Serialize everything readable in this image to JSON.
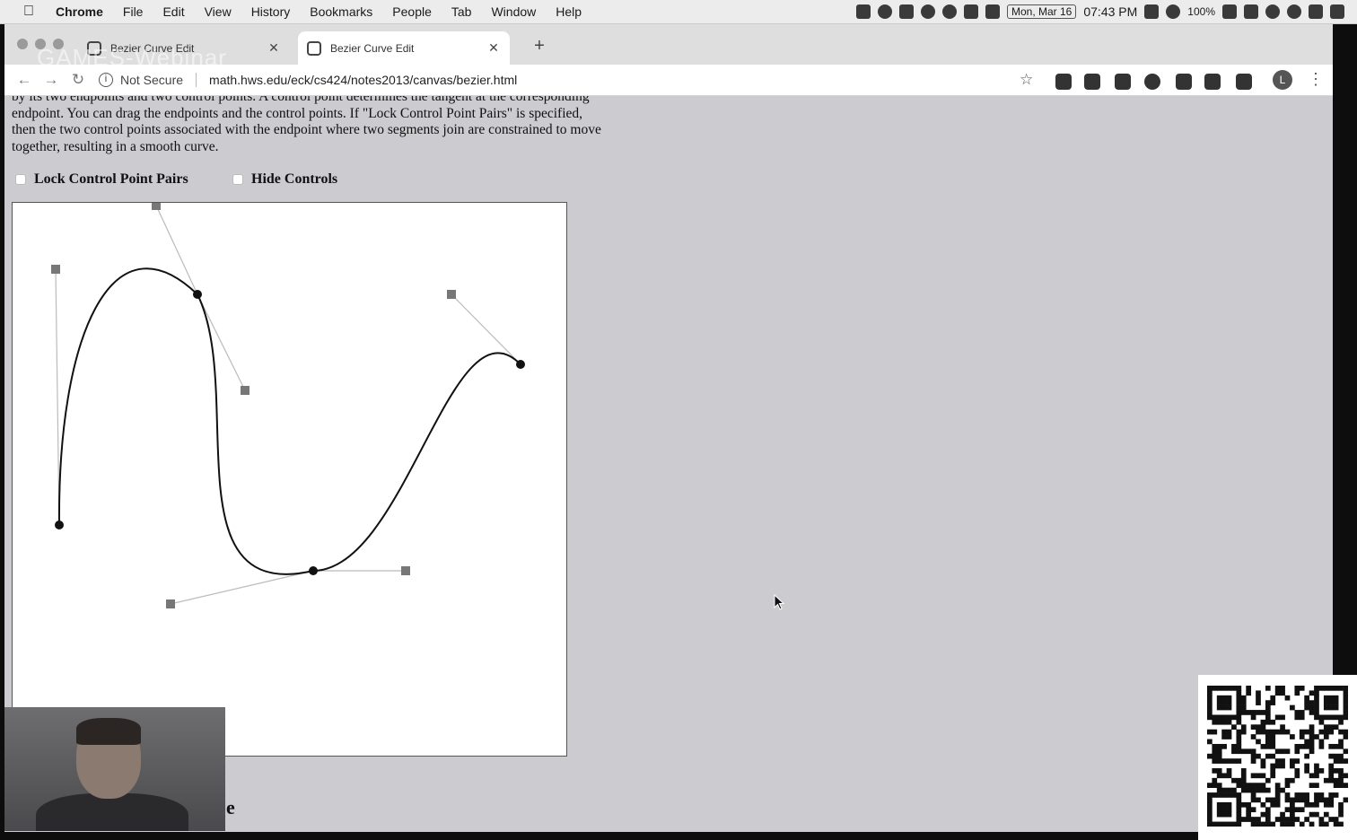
{
  "menubar": {
    "app": "Chrome",
    "items": [
      "File",
      "Edit",
      "View",
      "History",
      "Bookmarks",
      "People",
      "Tab",
      "Window",
      "Help"
    ],
    "date": "Mon, Mar 16",
    "time": "07:43 PM",
    "battery": "100%"
  },
  "tabs": [
    {
      "title": "Bezier Curve Edit"
    },
    {
      "title": "Bezier Curve Edit"
    }
  ],
  "watermark": "GAMES-Webinar",
  "toolbar": {
    "security": "Not Secure",
    "url": "math.hws.edu/eck/cs424/notes2013/canvas/bezier.html",
    "profile_initial": "L"
  },
  "page": {
    "intro": "by its two endpoints and two control points. A control point determines the tangent at the corresponding endpoint. You can drag the endpoints and the control points. If \"Lock Control Point Pairs\" is specified, then the two control points associated with the endpoint where two segments join are constrained to move together, resulting in a smooth curve.",
    "lock_label": "Lock Control Point Pairs",
    "hide_label": "Hide Controls",
    "lock_checked": false,
    "hide_checked": false,
    "heading_fragment": "e"
  },
  "colors": {
    "curve": "#111111",
    "control_point": "#777777",
    "control_line": "#bbbbbb",
    "page_bg": "#cbcbd0"
  }
}
